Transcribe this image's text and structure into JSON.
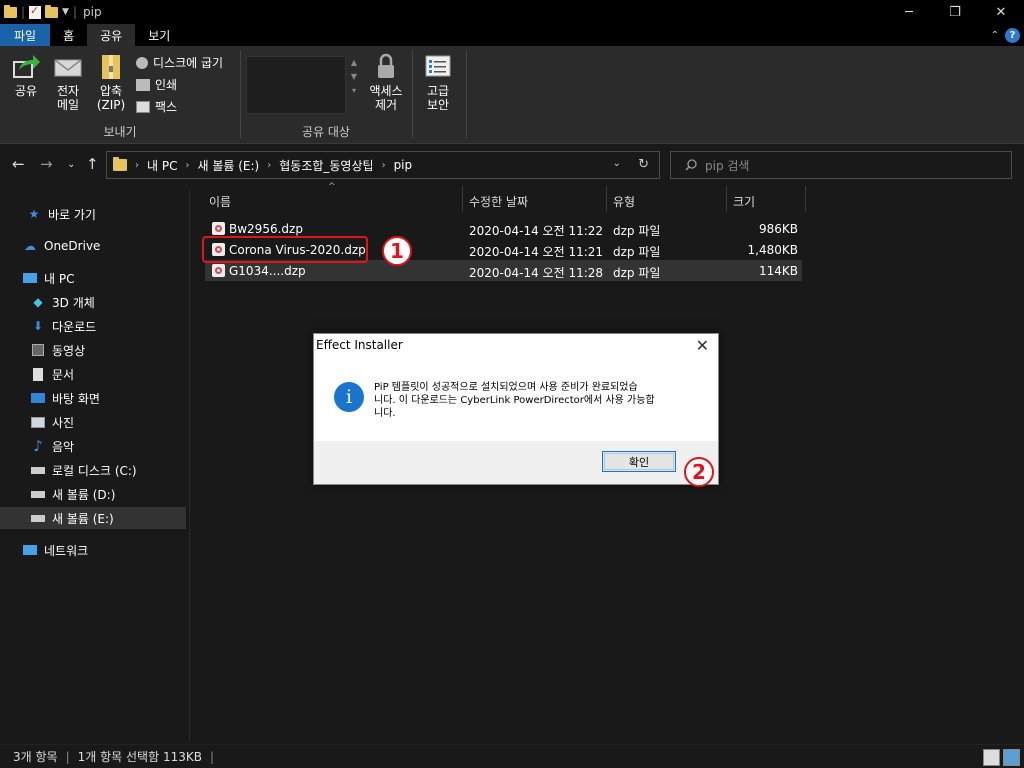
{
  "window": {
    "title": "pip"
  },
  "window_controls": {
    "minimize": "─",
    "maximize": "❐",
    "close": "✕"
  },
  "ribbon_tabs": [
    {
      "label": "파일"
    },
    {
      "label": "홈"
    },
    {
      "label": "공유"
    },
    {
      "label": "보기"
    }
  ],
  "ribbon": {
    "send_group": {
      "label": "보내기",
      "share": "공유",
      "email_1": "전자",
      "email_2": "메일",
      "zip_1": "압축",
      "zip_2": "(ZIP)",
      "burn": "디스크에 굽기",
      "print": "인쇄",
      "fax": "팩스"
    },
    "share_with_group": {
      "label": "공유 대상"
    },
    "remove_access_1": "액세스",
    "remove_access_2": "제거",
    "advanced_security_1": "고급",
    "advanced_security_2": "보안"
  },
  "address": {
    "crumbs": [
      "내 PC",
      "새 볼륨 (E:)",
      "협동조합_동영상팁",
      "pip"
    ]
  },
  "search": {
    "placeholder": "pip 검색"
  },
  "nav_pane": [
    {
      "label": "바로 가기"
    },
    {
      "label": "OneDrive"
    },
    {
      "label": "내 PC"
    },
    {
      "label": "3D 개체"
    },
    {
      "label": "다운로드"
    },
    {
      "label": "동영상"
    },
    {
      "label": "문서"
    },
    {
      "label": "바탕 화면"
    },
    {
      "label": "사진"
    },
    {
      "label": "음악"
    },
    {
      "label": "로컬 디스크 (C:)"
    },
    {
      "label": "새 볼륨 (D:)"
    },
    {
      "label": "새 볼륨 (E:)"
    },
    {
      "label": "네트워크"
    }
  ],
  "columns": {
    "name": "이름",
    "date": "수정한 날짜",
    "type": "유형",
    "size": "크기"
  },
  "files": [
    {
      "name": "Bw2956.dzp",
      "date": "2020-04-14 오전 11:22",
      "type": "dzp 파일",
      "size": "986KB"
    },
    {
      "name": "Corona Virus-2020.dzp",
      "date": "2020-04-14 오전 11:21",
      "type": "dzp 파일",
      "size": "1,480KB"
    },
    {
      "name": "G1034....dzp",
      "date": "2020-04-14 오전 11:28",
      "type": "dzp 파일",
      "size": "114KB"
    }
  ],
  "annotations": {
    "step1": "1",
    "step2": "2"
  },
  "dialog": {
    "title": "Effect Installer",
    "close": "✕",
    "message_line1": "PiP 템플릿이 성공적으로 설치되었으며 사용 준비가 완료되었습",
    "message_line2": "니다. 이 다운로드는 CyberLink PowerDirector에서 사용 가능합",
    "message_line3": "니다.",
    "ok": "확인"
  },
  "status": {
    "count": "3개 항목",
    "selection": "1개 항목 선택함 113KB"
  },
  "colors": {
    "file_tab": "#1a63a8",
    "highlight_red": "#e0141b",
    "info_blue": "#1874cd"
  }
}
